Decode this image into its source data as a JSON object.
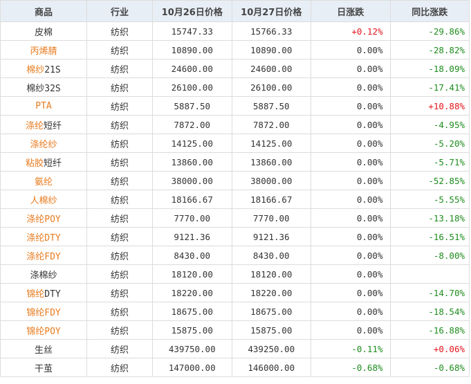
{
  "table": {
    "headers": [
      "商品",
      "行业",
      "10月26日价格",
      "10月27日价格",
      "日涨跌",
      "同比涨跌"
    ],
    "rows": [
      {
        "name": [
          "皮棉",
          ""
        ],
        "link": [
          false,
          false
        ],
        "industry": "纺织",
        "p1": "15747.33",
        "p2": "15766.33",
        "day": "+0.12%",
        "day_dir": "up",
        "yoy": "-29.86%",
        "yoy_dir": "down"
      },
      {
        "name": [
          "丙烯腈",
          ""
        ],
        "link": [
          true,
          false
        ],
        "industry": "纺织",
        "p1": "10890.00",
        "p2": "10890.00",
        "day": "0.00%",
        "day_dir": "flat",
        "yoy": "-28.82%",
        "yoy_dir": "down"
      },
      {
        "name": [
          "棉纱",
          "21S"
        ],
        "link": [
          true,
          false
        ],
        "industry": "纺织",
        "p1": "24600.00",
        "p2": "24600.00",
        "day": "0.00%",
        "day_dir": "flat",
        "yoy": "-18.09%",
        "yoy_dir": "down"
      },
      {
        "name": [
          "棉纱32S",
          ""
        ],
        "link": [
          false,
          false
        ],
        "industry": "纺织",
        "p1": "26100.00",
        "p2": "26100.00",
        "day": "0.00%",
        "day_dir": "flat",
        "yoy": "-17.41%",
        "yoy_dir": "down"
      },
      {
        "name": [
          "PTA",
          ""
        ],
        "link": [
          true,
          false
        ],
        "industry": "纺织",
        "p1": "5887.50",
        "p2": "5887.50",
        "day": "0.00%",
        "day_dir": "flat",
        "yoy": "+10.88%",
        "yoy_dir": "up"
      },
      {
        "name": [
          "涤纶",
          "短纤"
        ],
        "link": [
          true,
          false
        ],
        "industry": "纺织",
        "p1": "7872.00",
        "p2": "7872.00",
        "day": "0.00%",
        "day_dir": "flat",
        "yoy": "-4.95%",
        "yoy_dir": "down"
      },
      {
        "name": [
          "涤纶纱",
          ""
        ],
        "link": [
          true,
          false
        ],
        "industry": "纺织",
        "p1": "14125.00",
        "p2": "14125.00",
        "day": "0.00%",
        "day_dir": "flat",
        "yoy": "-5.20%",
        "yoy_dir": "down"
      },
      {
        "name": [
          "粘胶",
          "短纤"
        ],
        "link": [
          true,
          false
        ],
        "industry": "纺织",
        "p1": "13860.00",
        "p2": "13860.00",
        "day": "0.00%",
        "day_dir": "flat",
        "yoy": "-5.71%",
        "yoy_dir": "down"
      },
      {
        "name": [
          "氨纶",
          ""
        ],
        "link": [
          true,
          false
        ],
        "industry": "纺织",
        "p1": "38000.00",
        "p2": "38000.00",
        "day": "0.00%",
        "day_dir": "flat",
        "yoy": "-52.85%",
        "yoy_dir": "down"
      },
      {
        "name": [
          "人棉纱",
          ""
        ],
        "link": [
          true,
          false
        ],
        "industry": "纺织",
        "p1": "18166.67",
        "p2": "18166.67",
        "day": "0.00%",
        "day_dir": "flat",
        "yoy": "-5.55%",
        "yoy_dir": "down"
      },
      {
        "name": [
          "涤纶POY",
          ""
        ],
        "link": [
          true,
          false
        ],
        "industry": "纺织",
        "p1": "7770.00",
        "p2": "7770.00",
        "day": "0.00%",
        "day_dir": "flat",
        "yoy": "-13.18%",
        "yoy_dir": "down"
      },
      {
        "name": [
          "涤纶DTY",
          ""
        ],
        "link": [
          true,
          false
        ],
        "industry": "纺织",
        "p1": "9121.36",
        "p2": "9121.36",
        "day": "0.00%",
        "day_dir": "flat",
        "yoy": "-16.51%",
        "yoy_dir": "down"
      },
      {
        "name": [
          "涤纶FDY",
          ""
        ],
        "link": [
          true,
          false
        ],
        "industry": "纺织",
        "p1": "8430.00",
        "p2": "8430.00",
        "day": "0.00%",
        "day_dir": "flat",
        "yoy": "-8.00%",
        "yoy_dir": "down"
      },
      {
        "name": [
          "涤棉纱",
          ""
        ],
        "link": [
          false,
          false
        ],
        "industry": "纺织",
        "p1": "18120.00",
        "p2": "18120.00",
        "day": "0.00%",
        "day_dir": "flat",
        "yoy": "",
        "yoy_dir": "flat"
      },
      {
        "name": [
          "锦纶",
          "DTY"
        ],
        "link": [
          true,
          false
        ],
        "industry": "纺织",
        "p1": "18220.00",
        "p2": "18220.00",
        "day": "0.00%",
        "day_dir": "flat",
        "yoy": "-14.70%",
        "yoy_dir": "down"
      },
      {
        "name": [
          "锦纶FDY",
          ""
        ],
        "link": [
          true,
          false
        ],
        "industry": "纺织",
        "p1": "18675.00",
        "p2": "18675.00",
        "day": "0.00%",
        "day_dir": "flat",
        "yoy": "-18.54%",
        "yoy_dir": "down"
      },
      {
        "name": [
          "锦纶POY",
          ""
        ],
        "link": [
          true,
          false
        ],
        "industry": "纺织",
        "p1": "15875.00",
        "p2": "15875.00",
        "day": "0.00%",
        "day_dir": "flat",
        "yoy": "-16.88%",
        "yoy_dir": "down"
      },
      {
        "name": [
          "生丝",
          ""
        ],
        "link": [
          false,
          false
        ],
        "industry": "纺织",
        "p1": "439750.00",
        "p2": "439250.00",
        "day": "-0.11%",
        "day_dir": "down",
        "yoy": "+0.06%",
        "yoy_dir": "up"
      },
      {
        "name": [
          "干茧",
          ""
        ],
        "link": [
          false,
          false
        ],
        "industry": "纺织",
        "p1": "147000.00",
        "p2": "146000.00",
        "day": "-0.68%",
        "day_dir": "down",
        "yoy": "-0.68%",
        "yoy_dir": "down"
      }
    ]
  },
  "colors": {
    "header_bg": "#e8eef6",
    "link": "#e87b1e",
    "up": "#e4141b",
    "down": "#1c8c1c",
    "border": "#dcdcdc"
  }
}
